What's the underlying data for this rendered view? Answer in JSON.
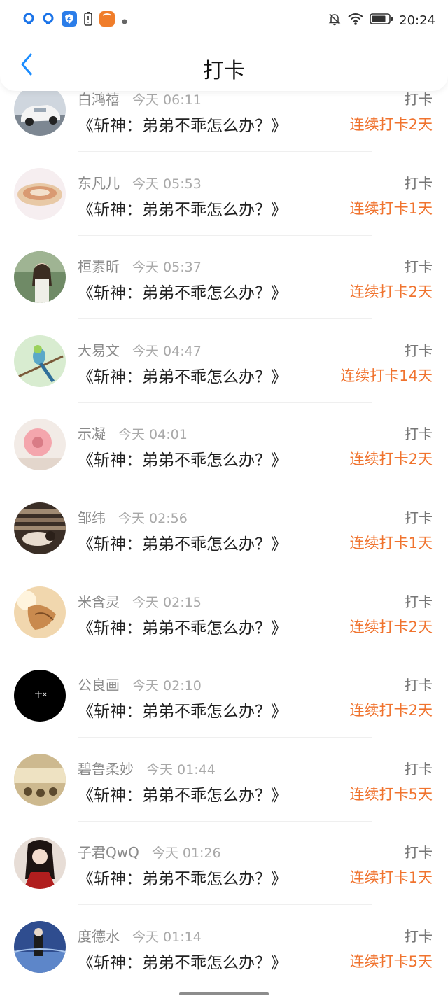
{
  "status_bar": {
    "time": "20:24",
    "icons": [
      "qq-icon",
      "qq-icon",
      "shield-app-icon",
      "battery-alert-icon",
      "orange-app-icon",
      "dot-icon",
      "bell-off-icon",
      "wifi-icon",
      "battery-icon"
    ]
  },
  "header": {
    "title": "打卡",
    "back_icon": "chevron-left-icon"
  },
  "colors": {
    "accent": "#f0732e",
    "back": "#1a8cff"
  },
  "items": [
    {
      "name": "白鸿禧",
      "time": "今天 06:11",
      "message": "《斩神：弟弟不乖怎么办？》",
      "label": "打卡",
      "streak": "连续打卡2天"
    },
    {
      "name": "东凡儿",
      "time": "今天 05:53",
      "message": "《斩神：弟弟不乖怎么办？》",
      "label": "打卡",
      "streak": "连续打卡1天"
    },
    {
      "name": "桓素昕",
      "time": "今天 05:37",
      "message": "《斩神：弟弟不乖怎么办？》",
      "label": "打卡",
      "streak": "连续打卡2天"
    },
    {
      "name": "大易文",
      "time": "今天 04:47",
      "message": "《斩神：弟弟不乖怎么办？》",
      "label": "打卡",
      "streak": "连续打卡14天"
    },
    {
      "name": "示凝",
      "time": "今天 04:01",
      "message": "《斩神：弟弟不乖怎么办？》",
      "label": "打卡",
      "streak": "连续打卡2天"
    },
    {
      "name": "邹纬",
      "time": "今天 02:56",
      "message": "《斩神：弟弟不乖怎么办？》",
      "label": "打卡",
      "streak": "连续打卡1天"
    },
    {
      "name": "米含灵",
      "time": "今天 02:15",
      "message": "《斩神：弟弟不乖怎么办？》",
      "label": "打卡",
      "streak": "连续打卡2天"
    },
    {
      "name": "公良画",
      "time": "今天 02:10",
      "message": "《斩神：弟弟不乖怎么办？》",
      "label": "打卡",
      "streak": "连续打卡2天"
    },
    {
      "name": "碧鲁柔妙",
      "time": "今天 01:44",
      "message": "《斩神：弟弟不乖怎么办？》",
      "label": "打卡",
      "streak": "连续打卡5天"
    },
    {
      "name": "子君QwQ",
      "time": "今天 01:26",
      "message": "《斩神：弟弟不乖怎么办？》",
      "label": "打卡",
      "streak": "连续打卡1天"
    },
    {
      "name": "度德水",
      "time": "今天 01:14",
      "message": "《斩神：弟弟不乖怎么办？》",
      "label": "打卡",
      "streak": "连续打卡5天"
    }
  ]
}
